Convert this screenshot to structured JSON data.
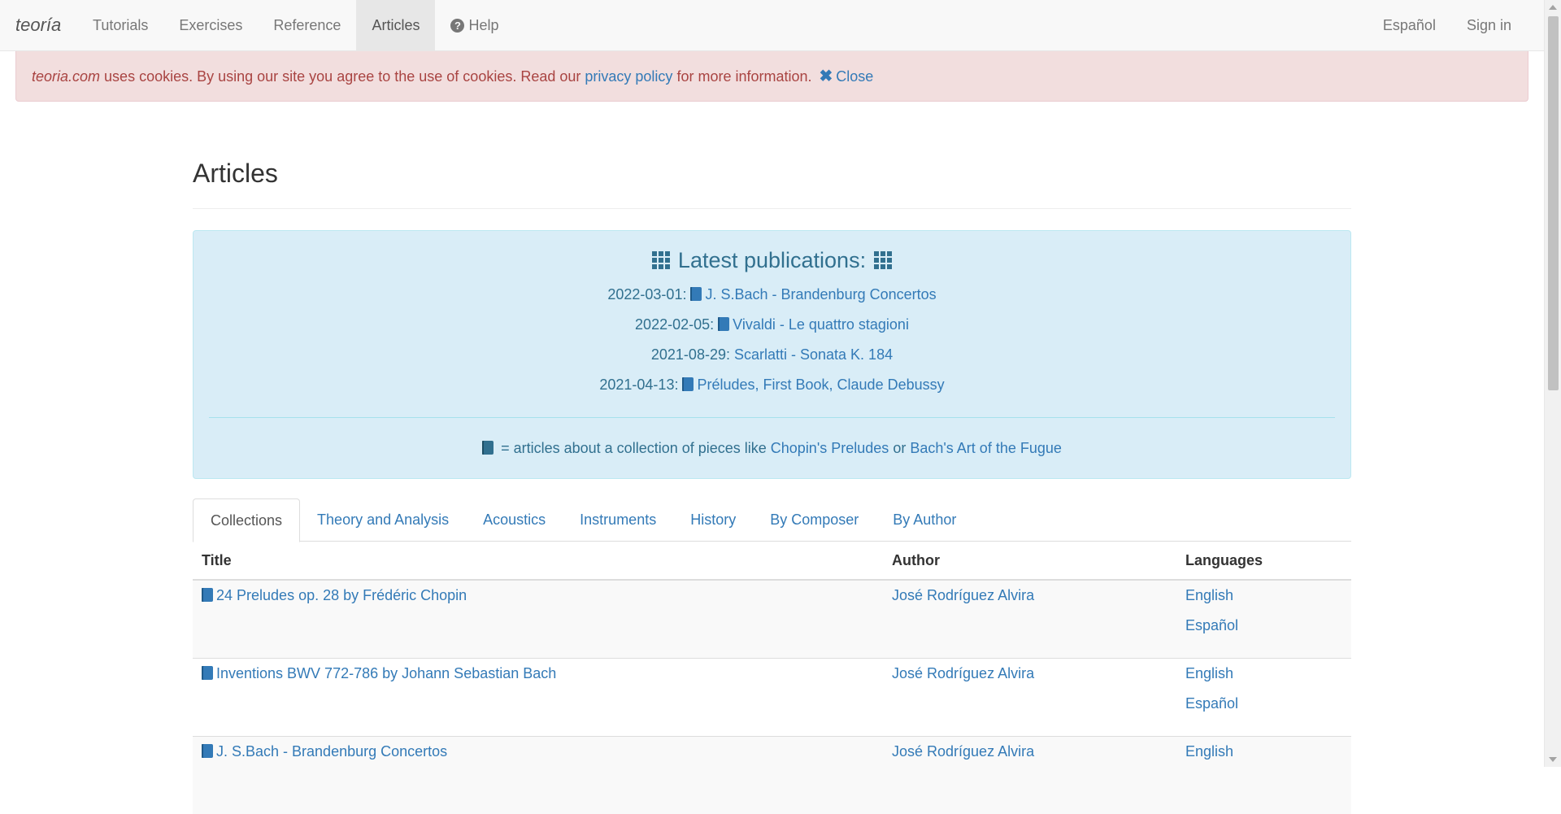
{
  "navbar": {
    "brand": "teoría",
    "items": [
      {
        "label": "Tutorials"
      },
      {
        "label": "Exercises"
      },
      {
        "label": "Reference"
      },
      {
        "label": "Articles"
      },
      {
        "label": "Help",
        "icon": "question-circle-icon"
      }
    ],
    "right_items": [
      {
        "label": "Español"
      },
      {
        "label": "Sign in"
      }
    ]
  },
  "cookie_alert": {
    "site": "teoria.com",
    "text_before": " uses cookies. By using our site you agree to the use of cookies. Read our ",
    "link": "privacy policy",
    "text_after": " for more information. ",
    "close_label": "Close",
    "colors": {
      "background": "#f2dede",
      "text": "#a94442"
    }
  },
  "page": {
    "title": "Articles"
  },
  "latest": {
    "heading": "Latest publications:",
    "items": [
      {
        "date": "2022-03-01:",
        "title": "J. S.Bach - Brandenburg Concertos",
        "collection": true
      },
      {
        "date": "2022-02-05:",
        "title": "Vivaldi - Le quattro stagioni",
        "collection": true
      },
      {
        "date": "2021-08-29:",
        "title": "Scarlatti - Sonata K. 184",
        "collection": false
      },
      {
        "date": "2021-04-13:",
        "title": "Préludes, First Book, Claude Debussy",
        "collection": true
      }
    ],
    "note_prefix": " = articles about a collection of pieces like ",
    "note_link1": "Chopin's Preludes",
    "note_middle": " or ",
    "note_link2": "Bach's Art of the Fugue",
    "colors": {
      "background": "#d9edf7",
      "text": "#31708f"
    }
  },
  "tabs": [
    {
      "label": "Collections",
      "active": true
    },
    {
      "label": "Theory and Analysis"
    },
    {
      "label": "Acoustics"
    },
    {
      "label": "Instruments"
    },
    {
      "label": "History"
    },
    {
      "label": "By Composer"
    },
    {
      "label": "By Author"
    }
  ],
  "table": {
    "headers": {
      "title": "Title",
      "author": "Author",
      "languages": "Languages"
    },
    "rows": [
      {
        "title": "24 Preludes op. 28 by Frédéric Chopin",
        "author": "José Rodríguez Alvira",
        "languages": [
          "English",
          "Español"
        ]
      },
      {
        "title": "Inventions BWV 772-786 by Johann Sebastian Bach",
        "author": "José Rodríguez Alvira",
        "languages": [
          "English",
          "Español"
        ]
      },
      {
        "title": "J. S.Bach - Brandenburg Concertos",
        "author": "José Rodríguez Alvira",
        "languages": [
          "English"
        ]
      }
    ]
  },
  "colors": {
    "link": "#337ab7",
    "navbar_bg": "#f8f8f8"
  }
}
